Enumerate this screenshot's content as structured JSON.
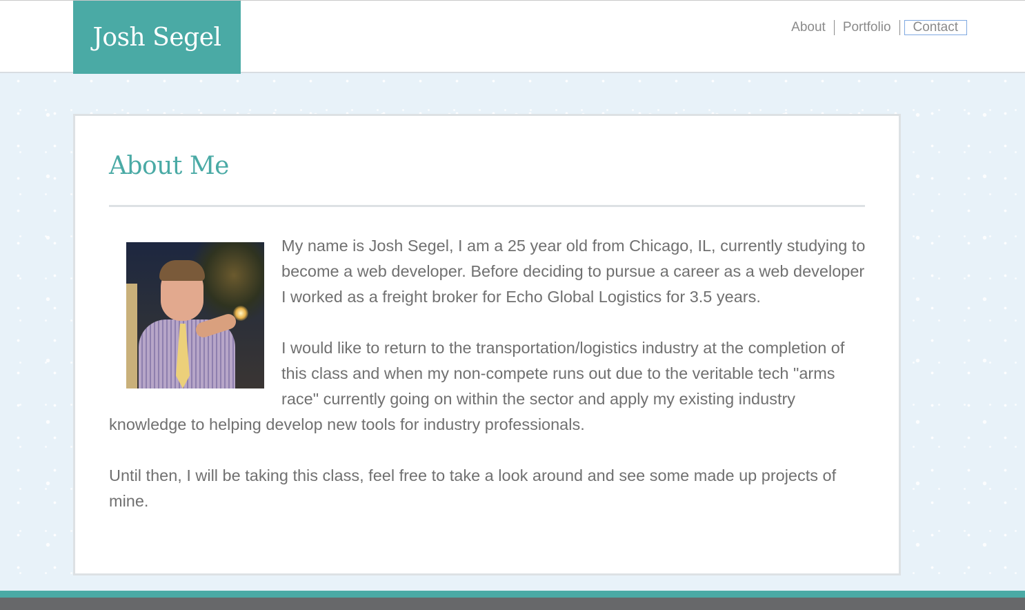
{
  "brand": {
    "name": "Josh Segel"
  },
  "nav": {
    "items": [
      {
        "label": "About"
      },
      {
        "label": "Portfolio"
      },
      {
        "label": "Contact"
      }
    ]
  },
  "main": {
    "heading": "About Me",
    "photo_icon": "profile-photo",
    "paragraphs": [
      "My name is Josh Segel, I am a 25 year old from Chicago, IL, currently studying to become a web developer. Before deciding to pursue a career as a web developer I worked as a freight broker for Echo Global Logistics for 3.5 years.",
      "I would like to return to the transportation/logistics industry at the completion of this class and when my non-compete runs out due to the veritable tech \"arms race\" currently going on within the sector and apply my existing industry knowledge to helping develop new tools for industry professionals.",
      "Until then, I will be taking this class, feel free to take a look around and see some made up projects of mine."
    ]
  },
  "colors": {
    "accent": "#4aaaa5",
    "text": "#707070",
    "background": "#e8f2f9",
    "footer": "#67686a"
  }
}
